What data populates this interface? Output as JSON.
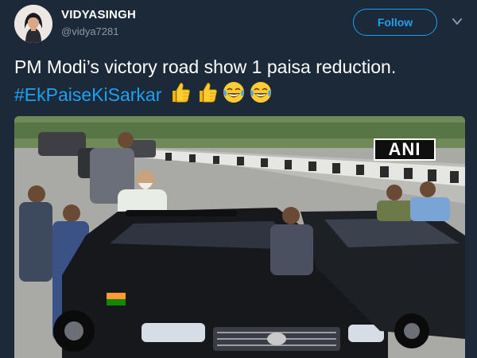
{
  "user": {
    "display_name": "VIDYASINGH",
    "handle": "@vidya7281"
  },
  "actions": {
    "follow_label": "Follow"
  },
  "tweet": {
    "text_before": "PM Modi’s victory road show 1 paisa reduction. ",
    "hashtag": "#EkPaiseKiSarkar",
    "emojis": [
      "thumbs-up",
      "thumbs-up",
      "face-with-tears-of-joy",
      "face-with-tears-of-joy"
    ]
  },
  "media": {
    "watermark": "ANI"
  },
  "colors": {
    "background": "#1c2938",
    "accent": "#1da1f2",
    "muted": "#8899a6"
  }
}
